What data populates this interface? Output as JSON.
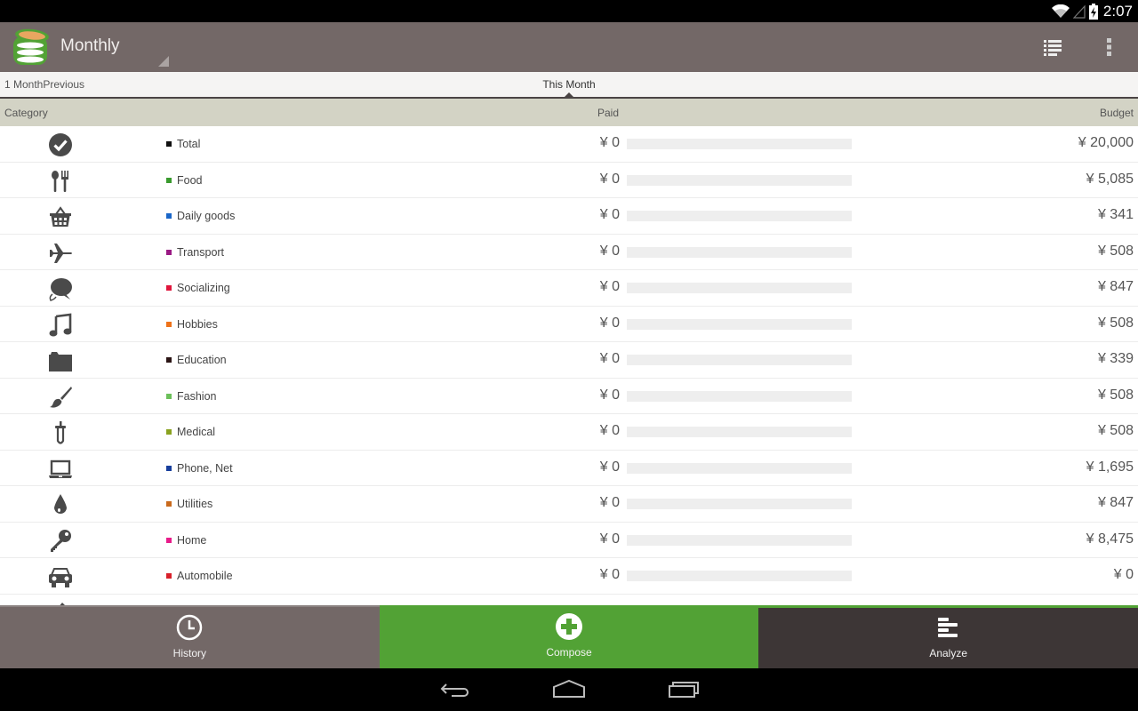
{
  "status_bar": {
    "time": "2:07",
    "icons": [
      "wifi-icon",
      "signal-icon",
      "battery-charging-icon"
    ]
  },
  "action_bar": {
    "title": "Monthly",
    "icons": [
      "list-view-icon",
      "overflow-menu-icon"
    ]
  },
  "period_tabs": {
    "previous": "1 MonthPrevious",
    "current": "This Month"
  },
  "table": {
    "columns": {
      "category": "Category",
      "paid": "Paid",
      "budget": "Budget"
    },
    "rows": [
      {
        "icon": "checkmark-circle-icon",
        "name": "Total",
        "color": "#111111",
        "paid": "¥ 0",
        "progress": 0,
        "budget": "¥ 20,000"
      },
      {
        "icon": "utensils-icon",
        "name": "Food",
        "color": "#3a9a2e",
        "paid": "¥ 0",
        "progress": 0,
        "budget": "¥ 5,085"
      },
      {
        "icon": "basket-icon",
        "name": "Daily goods",
        "color": "#1a66c8",
        "paid": "¥ 0",
        "progress": 0,
        "budget": "¥ 341"
      },
      {
        "icon": "airplane-icon",
        "name": "Transport",
        "color": "#9a1a84",
        "paid": "¥ 0",
        "progress": 0,
        "budget": "¥ 508"
      },
      {
        "icon": "chat-bubbles-icon",
        "name": "Socializing",
        "color": "#e0163c",
        "paid": "¥ 0",
        "progress": 0,
        "budget": "¥ 847"
      },
      {
        "icon": "music-note-icon",
        "name": "Hobbies",
        "color": "#ee7219",
        "paid": "¥ 0",
        "progress": 0,
        "budget": "¥ 508"
      },
      {
        "icon": "folder-icon",
        "name": "Education",
        "color": "#2a1414",
        "paid": "¥ 0",
        "progress": 0,
        "budget": "¥ 339"
      },
      {
        "icon": "brush-icon",
        "name": "Fashion",
        "color": "#6cc05a",
        "paid": "¥ 0",
        "progress": 0,
        "budget": "¥ 508"
      },
      {
        "icon": "dropper-icon",
        "name": "Medical",
        "color": "#8aa220",
        "paid": "¥ 0",
        "progress": 0,
        "budget": "¥ 508"
      },
      {
        "icon": "laptop-icon",
        "name": "Phone, Net",
        "color": "#173e9c",
        "paid": "¥ 0",
        "progress": 0,
        "budget": "¥ 1,695"
      },
      {
        "icon": "water-drop-icon",
        "name": "Utilities",
        "color": "#c96a1c",
        "paid": "¥ 0",
        "progress": 0,
        "budget": "¥ 847"
      },
      {
        "icon": "key-icon",
        "name": "Home",
        "color": "#e81c8a",
        "paid": "¥ 0",
        "progress": 0,
        "budget": "¥ 8,475"
      },
      {
        "icon": "car-icon",
        "name": "Automobile",
        "color": "#d8202a",
        "paid": "¥ 0",
        "progress": 0,
        "budget": "¥ 0"
      }
    ]
  },
  "bottom_nav": {
    "history": "History",
    "compose": "Compose",
    "analyze": "Analyze"
  },
  "system_nav": [
    "back-icon",
    "home-icon",
    "recent-apps-icon"
  ],
  "colors": {
    "action_bar": "#736867",
    "accent_green": "#52a235",
    "header_band": "#d3d3c5",
    "analyze_bg": "#3d3636"
  }
}
